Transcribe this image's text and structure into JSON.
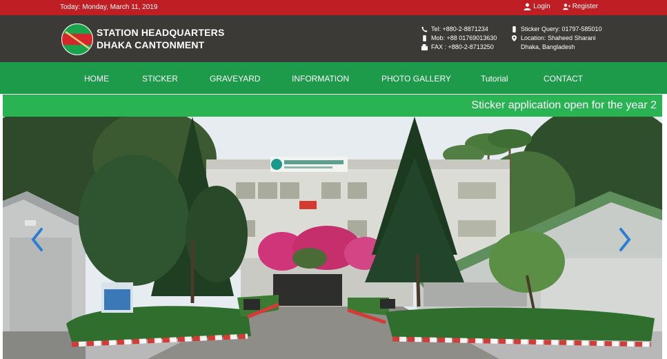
{
  "topbar": {
    "date_text": "Today: Monday, March 11, 2019",
    "login_label": "Login",
    "register_label": "Register"
  },
  "header": {
    "title_line1": "STATION HEADQUARTERS",
    "title_line2": "DHAKA CANTONMENT",
    "tel": "Tel: +880-2-8871234",
    "mob": "Mob: +88 01769013630",
    "fax": "FAX : +880-2-8713250",
    "sticker_query": "Sticker Query: 01797-585010",
    "location_line1": "Location: Shaheed Sharani",
    "location_line2": "Dhaka, Bangladesh"
  },
  "nav": {
    "items": [
      {
        "label": "HOME"
      },
      {
        "label": "STICKER"
      },
      {
        "label": "GRAVEYARD"
      },
      {
        "label": "INFORMATION"
      },
      {
        "label": "PHOTO GALLERY"
      },
      {
        "label": "Tutorial"
      },
      {
        "label": "CONTACT"
      }
    ]
  },
  "ticker": {
    "text": "Sticker application open for the year 2"
  },
  "colors": {
    "topbar": "#bf1e24",
    "header": "#3b3a37",
    "nav": "#1e9a4b",
    "ticker": "#2ab352",
    "slider_arrow": "#2a7fd4"
  },
  "icons": {
    "login": "user-icon",
    "register": "user-plus-icon",
    "tel": "phone-icon",
    "mob": "mobile-icon",
    "fax": "fax-icon",
    "sticker_query": "mobile-icon",
    "location": "map-pin-icon",
    "prev": "chevron-left-icon",
    "next": "chevron-right-icon"
  }
}
